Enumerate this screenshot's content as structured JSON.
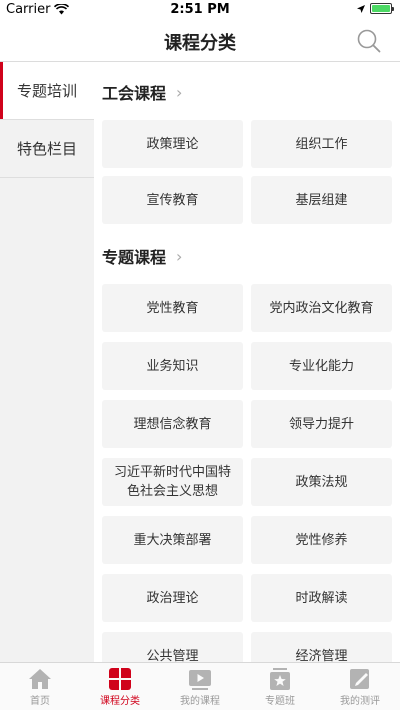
{
  "status_bar": {
    "carrier": "Carrier",
    "time": "2:51 PM"
  },
  "nav": {
    "title": "课程分类"
  },
  "sidebar": {
    "items": [
      {
        "label": "专题培训",
        "active": true
      },
      {
        "label": "特色栏目",
        "active": false
      }
    ]
  },
  "sections": [
    {
      "title": "工会课程",
      "tiles": [
        "政策理论",
        "组织工作",
        "宣传教育",
        "基层组建"
      ]
    },
    {
      "title": "专题课程",
      "tiles": [
        "党性教育",
        "党内政治文化教育",
        "业务知识",
        "专业化能力",
        "理想信念教育",
        "领导力提升",
        "习近平新时代中国特色社会主义思想",
        "政策法规",
        "重大决策部署",
        "党性修养",
        "政治理论",
        "时政解读",
        "公共管理",
        "经济管理"
      ]
    }
  ],
  "tab_bar": {
    "tabs": [
      {
        "label": "首页",
        "icon": "home-icon",
        "active": false
      },
      {
        "label": "课程分类",
        "icon": "category-icon",
        "active": true
      },
      {
        "label": "我的课程",
        "icon": "video-icon",
        "active": false
      },
      {
        "label": "专题班",
        "icon": "star-board-icon",
        "active": false
      },
      {
        "label": "我的测评",
        "icon": "test-icon",
        "active": false
      }
    ]
  },
  "colors": {
    "accent": "#d0021b",
    "tile_bg": "#f4f4f4",
    "sidebar_bg": "#f2f2f2"
  }
}
